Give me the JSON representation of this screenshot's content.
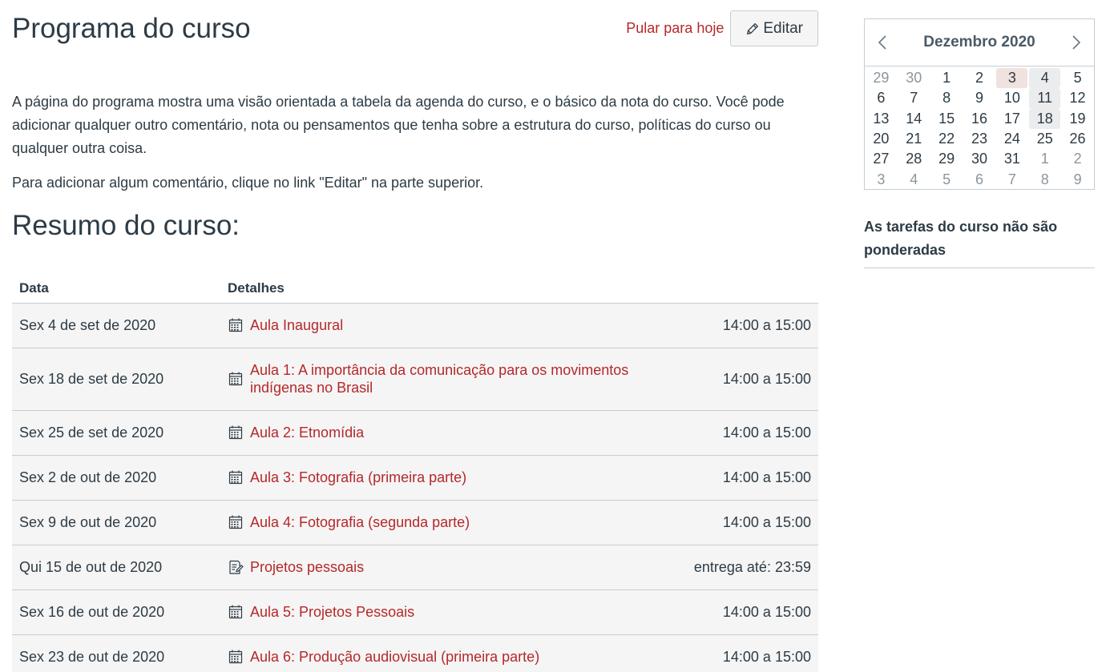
{
  "header": {
    "title": "Programa do curso",
    "jump_today": "Pular para hoje",
    "edit_label": "Editar"
  },
  "description": {
    "paragraph1": "A página do programa mostra uma visão orientada a tabela da agenda do curso, e o básico da nota do curso. Você pode adicionar qualquer outro comentário, nota ou pensamentos que tenha sobre a estrutura do curso, políticas do curso ou qualquer outra coisa.",
    "paragraph2": "Para adicionar algum comentário, clique no link \"Editar\" na parte superior."
  },
  "summary": {
    "title": "Resumo do curso:",
    "col_date": "Data",
    "col_details": "Detalhes",
    "rows": [
      {
        "date": "Sex 4 de set de 2020",
        "icon": "calendar-icon",
        "title": "Aula Inaugural",
        "time": "14:00 a 15:00"
      },
      {
        "date": "Sex 18 de set de 2020",
        "icon": "calendar-icon",
        "title": "Aula 1: A importância da comunicação para os movimentos indígenas no Brasil",
        "time": "14:00 a 15:00"
      },
      {
        "date": "Sex 25 de set de 2020",
        "icon": "calendar-icon",
        "title": "Aula 2: Etnomídia",
        "time": "14:00 a 15:00"
      },
      {
        "date": "Sex 2 de out de 2020",
        "icon": "calendar-icon",
        "title": "Aula 3: Fotografia (primeira parte)",
        "time": "14:00 a 15:00"
      },
      {
        "date": "Sex 9 de out de 2020",
        "icon": "calendar-icon",
        "title": "Aula 4: Fotografia (segunda parte)",
        "time": "14:00 a 15:00"
      },
      {
        "date": "Qui 15 de out de 2020",
        "icon": "assignment-icon",
        "title": "Projetos pessoais",
        "time": "entrega até: 23:59"
      },
      {
        "date": "Sex 16 de out de 2020",
        "icon": "calendar-icon",
        "title": "Aula 5: Projetos Pessoais",
        "time": "14:00 a 15:00"
      },
      {
        "date": "Sex 23 de out de 2020",
        "icon": "calendar-icon",
        "title": "Aula 6: Produção audiovisual (primeira parte)",
        "time": "14:00 a 15:00"
      }
    ]
  },
  "calendar": {
    "month_label": "Dezembro 2020",
    "weeks": [
      [
        "29",
        "30",
        "1",
        "2",
        "3",
        "4",
        "5"
      ],
      [
        "6",
        "7",
        "8",
        "9",
        "10",
        "11",
        "12"
      ],
      [
        "13",
        "14",
        "15",
        "16",
        "17",
        "18",
        "19"
      ],
      [
        "20",
        "21",
        "22",
        "23",
        "24",
        "25",
        "26"
      ],
      [
        "27",
        "28",
        "29",
        "30",
        "31",
        "1",
        "2"
      ],
      [
        "3",
        "4",
        "5",
        "6",
        "7",
        "8",
        "9"
      ]
    ],
    "today": "3",
    "event_days": [
      "4",
      "11",
      "18"
    ]
  },
  "sidebar": {
    "weights_text": "As tarefas do curso não são ponderadas"
  }
}
